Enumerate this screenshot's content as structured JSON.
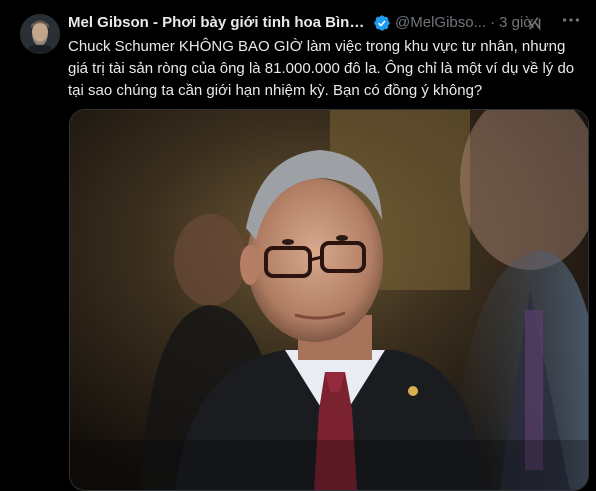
{
  "tweet": {
    "author": {
      "display_name": "Mel Gibson - Phơi bày giới tinh hoa Bình ...",
      "handle": "@MelGibso...",
      "verified": true
    },
    "time": "3 giờ",
    "separator": "·",
    "text_lines": [
      "Chuck Schumer KHÔNG BAO GIỜ làm việc trong khu vực tư nhân, nhưng",
      "giá trị tài sản ròng của ông là 81.000.000 đô la. Ông chỉ là một ví dụ về lý do",
      "tại sao chúng ta cần giới hạn nhiệm kỳ. Bạn có đồng ý không?"
    ],
    "media": {
      "type": "photo"
    }
  },
  "icons": {
    "avatar": "avatar-icon",
    "verified": "verified-badge-icon",
    "grok": "grok-icon",
    "more": "more-options-icon"
  },
  "colors": {
    "background": "#000000",
    "text_primary": "#e7e9ea",
    "text_secondary": "#71767b",
    "verified_blue": "#1d9bf0",
    "border": "#2f3336"
  }
}
